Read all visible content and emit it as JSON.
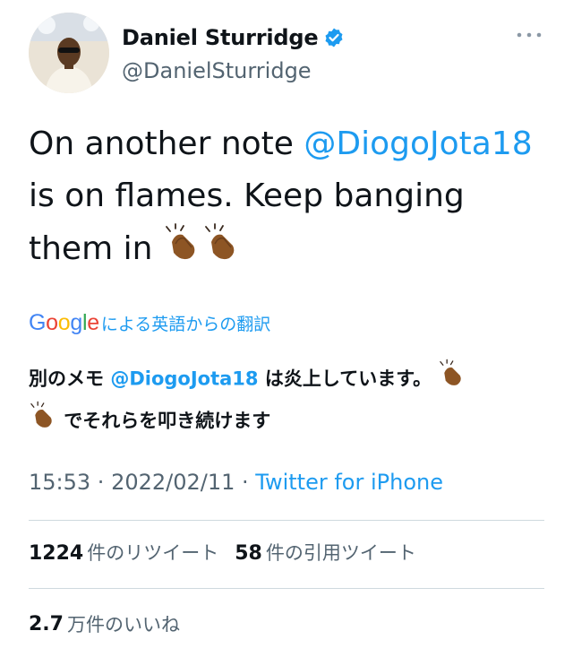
{
  "author": {
    "display_name": "Daniel Sturridge",
    "handle": "@DanielSturridge",
    "verified": true
  },
  "tweet": {
    "text_part1": "On another note ",
    "mention": "@DiogoJota18",
    "text_part2": " is on flames. Keep banging them in "
  },
  "translation": {
    "provider": "Google",
    "label": "による英語からの翻訳",
    "text_part1": "別のメモ ",
    "mention": "@DiogoJota18",
    "text_part2": " は炎上しています。 ",
    "text_part3": " でそれらを叩き続けます"
  },
  "meta": {
    "time": "15:53",
    "separator": " · ",
    "date": "2022/02/11",
    "source": "Twitter for iPhone"
  },
  "stats": {
    "retweets_count": "1224",
    "retweets_label": "件のリツイート",
    "quotes_count": "58",
    "quotes_label": "件の引用ツイート",
    "likes_count": "2.7",
    "likes_label": "万件のいいね"
  },
  "colors": {
    "accent": "#1d9bf0",
    "secondary_text": "#536471",
    "divider": "#cfd9de"
  },
  "icons": [
    "verified-badge-icon",
    "more-options-icon",
    "clapping-hands-icon"
  ]
}
